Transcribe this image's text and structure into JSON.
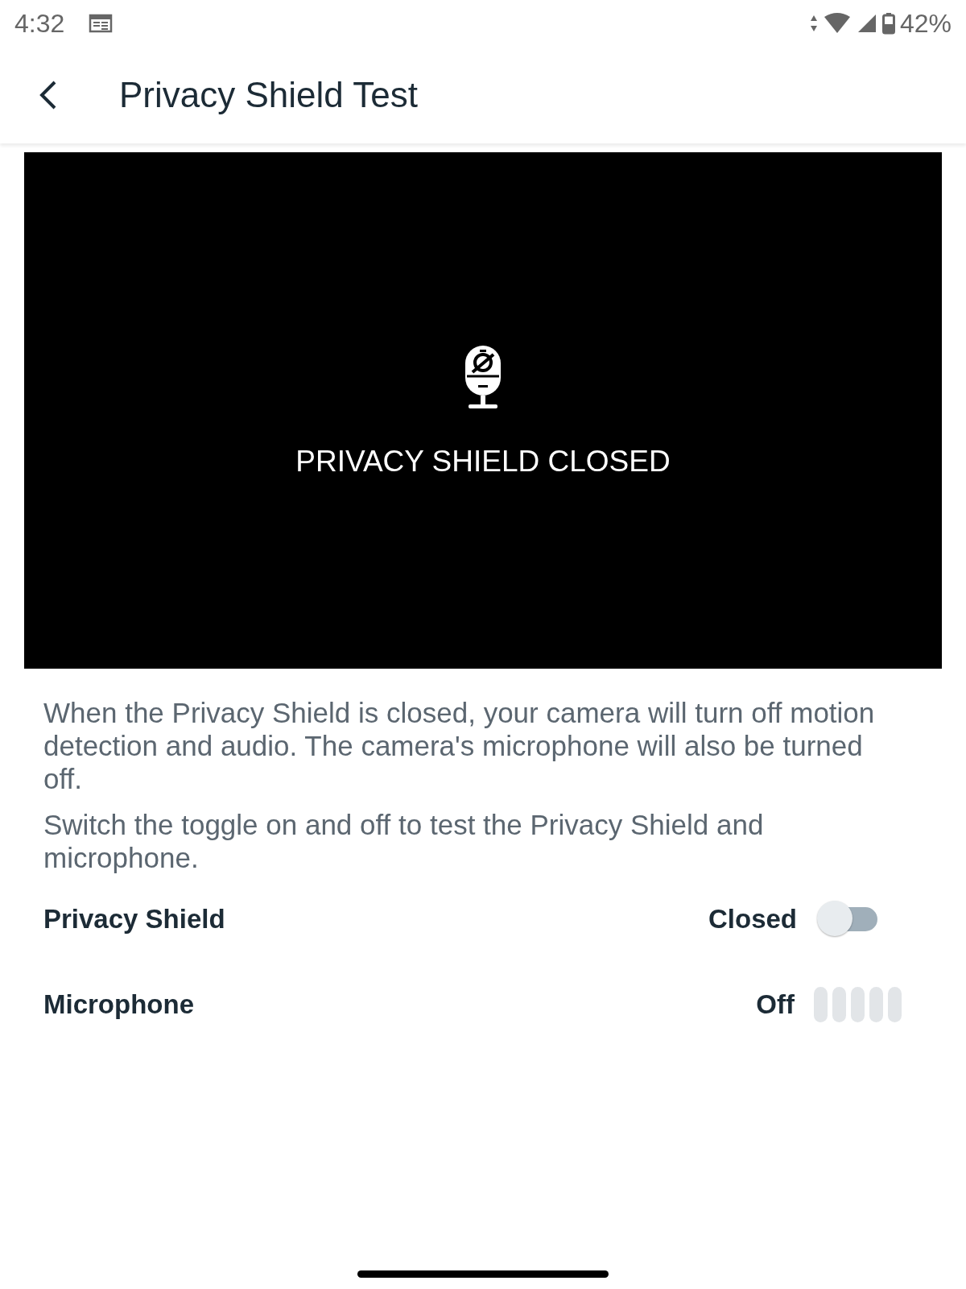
{
  "status_bar": {
    "time": "4:32",
    "battery": "42%"
  },
  "header": {
    "title": "Privacy Shield Test"
  },
  "video": {
    "kind": "shield_closed",
    "message": "PRIVACY SHIELD CLOSED"
  },
  "paragraphs": [
    "When the Privacy Shield is closed, your camera will turn off motion detection and audio. The camera's microphone will also be turned off.",
    "Switch the toggle on and off to test the Privacy Shield and microphone."
  ],
  "settings": [
    {
      "kind": "toggle",
      "label": "Privacy Shield",
      "value": "Closed",
      "on": false
    },
    {
      "kind": "meter",
      "label": "Microphone",
      "value": "Off"
    }
  ]
}
